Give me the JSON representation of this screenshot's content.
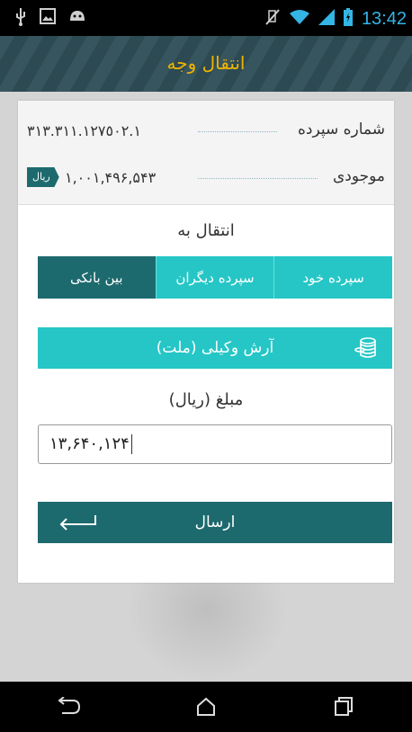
{
  "status_bar": {
    "time": "13:42",
    "left_icons": [
      "usb-icon",
      "image-icon",
      "android-icon"
    ],
    "right_icons": [
      "mute-icon",
      "wifi-icon",
      "signal-icon",
      "battery-icon"
    ]
  },
  "app_bar": {
    "title": "انتقال وجه"
  },
  "account": {
    "label": "شماره سپرده",
    "value": "٣١٣.٣١١.١٢٧٥٠٢.١"
  },
  "balance": {
    "label": "موجودی",
    "value": "١,٠٠١,۴٩۶,۵۴٣",
    "currency_badge": "ریال"
  },
  "transfer_to": {
    "label": "انتقال به",
    "options": [
      "سپرده خود",
      "سپرده دیگران",
      "بین بانکی"
    ],
    "selected": "بین بانکی"
  },
  "destination": {
    "name": "آرش وکیلی (ملت)"
  },
  "amount": {
    "label": "مبلغ (ریال)",
    "value": "١٣,۶۴٠,١٢۴"
  },
  "send_button": {
    "label": "ارسال"
  },
  "colors": {
    "teal": "#26c6c6",
    "dark_teal": "#1d6a6e",
    "app_bar": "#2f4e57",
    "title_gold": "#f0b400"
  }
}
